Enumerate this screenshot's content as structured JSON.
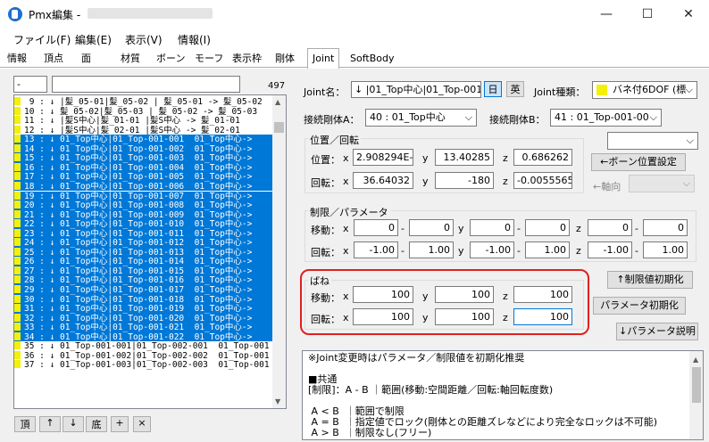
{
  "window": {
    "title": "Pmx編集 -",
    "minimize": "—",
    "maximize": "☐",
    "close": "✕"
  },
  "menu": [
    "ファイル(F)",
    "編集(E)",
    "表示(V)",
    "情報(I)"
  ],
  "tabs": [
    "情報",
    "頂点",
    "面",
    "材質",
    "ボーン",
    "モーフ",
    "表示枠",
    "剛体",
    "Joint",
    "SoftBody"
  ],
  "active_tab": "Joint",
  "list": {
    "filter_value": "-",
    "count": "497",
    "rows": [
      {
        "text": " 9 : ↓ |髪_05-01|髪_05-02 | 髪_05-01 -> 髪_05-02",
        "sel": false
      },
      {
        "text": "10 : ↓ 髪_05-02|髪_05-03 | 髪_05-02 -> 髪_05-03",
        "sel": false
      },
      {
        "text": "11 : ↓ |髪S中心|髪_01-01 |髪S中心 -> 髪_01-01",
        "sel": false
      },
      {
        "text": "12 : ↓ |髪S中心|髪_02-01 |髪S中心 -> 髪_02-01",
        "sel": false
      },
      {
        "text": "13 : ↓ 01_Top中心|01_Top-001-001  01_Top中心->",
        "sel": true
      },
      {
        "text": "14 : ↓ 01_Top中心|01_Top-001-002  01_Top中心->",
        "sel": true
      },
      {
        "text": "15 : ↓ 01_Top中心|01_Top-001-003  01_Top中心->",
        "sel": true
      },
      {
        "text": "16 : ↓ 01_Top中心|01_Top-001-004  01_Top中心->",
        "sel": true
      },
      {
        "text": "17 : ↓ 01_Top中心|01_Top-001-005  01_Top中心->",
        "sel": true
      },
      {
        "text": "18 : ↓ 01_Top中心|01_Top-001-006  01_Top中心->",
        "sel": true
      },
      {
        "text": "19 : ↓ 01_Top中心|01_Top-001-007  01_Top中心->",
        "sel": true
      },
      {
        "text": "20 : ↓ 01_Top中心|01_Top-001-008  01_Top中心->",
        "sel": true
      },
      {
        "text": "21 : ↓ 01_Top中心|01_Top-001-009  01_Top中心->",
        "sel": true
      },
      {
        "text": "22 : ↓ 01_Top中心|01_Top-001-010  01_Top中心->",
        "sel": true
      },
      {
        "text": "23 : ↓ 01_Top中心|01_Top-001-011  01_Top中心->",
        "sel": true
      },
      {
        "text": "24 : ↓ 01_Top中心|01_Top-001-012  01_Top中心->",
        "sel": true
      },
      {
        "text": "25 : ↓ 01_Top中心|01_Top-001-013  01_Top中心->",
        "sel": true
      },
      {
        "text": "26 : ↓ 01_Top中心|01_Top-001-014  01_Top中心->",
        "sel": true
      },
      {
        "text": "27 : ↓ 01_Top中心|01_Top-001-015  01_Top中心->",
        "sel": true
      },
      {
        "text": "28 : ↓ 01_Top中心|01_Top-001-016  01_Top中心->",
        "sel": true
      },
      {
        "text": "29 : ↓ 01_Top中心|01_Top-001-017  01_Top中心->",
        "sel": true
      },
      {
        "text": "30 : ↓ 01_Top中心|01_Top-001-018  01_Top中心->",
        "sel": true
      },
      {
        "text": "31 : ↓ 01_Top中心|01_Top-001-019  01_Top中心->",
        "sel": true
      },
      {
        "text": "32 : ↓ 01_Top中心|01_Top-001-020  01_Top中心->",
        "sel": true
      },
      {
        "text": "33 : ↓ 01_Top中心|01_Top-001-021  01_Top中心->",
        "sel": true
      },
      {
        "text": "34 : ↓ 01_Top中心|01_Top-001-022  01_Top中心->",
        "sel": true
      },
      {
        "text": "35 : ↓ 01_Top-001-001|01_Top-002-001  01_Top-001",
        "sel": false
      },
      {
        "text": "36 : ↓ 01_Top-001-002|01_Top-002-002  01_Top-001",
        "sel": false
      },
      {
        "text": "37 : ↓ 01_Top-001-003|01_Top-002-003  01_Top-001",
        "sel": false
      }
    ],
    "buttons": [
      "頂",
      "↑",
      "↓",
      "底",
      "+",
      "×"
    ]
  },
  "joint": {
    "name_label": "Joint名：",
    "name_value": "↓ |01_Top中心|01_Top-001-",
    "lang_jp": "日",
    "lang_en": "英",
    "type_label": "Joint種類：",
    "type_value": "バネ付6DOF (標",
    "body_a_label": "接続剛体A：",
    "body_a_value": "40 : 01_Top中心",
    "body_b_label": "接続剛体B：",
    "body_b_value": "41 : 01_Top-001-00"
  },
  "posrot": {
    "title": "位置／回転",
    "pos_label": "位置：",
    "rot_label": "回転：",
    "x": "x",
    "y": "y",
    "z": "z",
    "pos": [
      "2.908294E-(",
      "13.40285",
      "0.686262"
    ],
    "rot": [
      "36.64032",
      "-180",
      "-0.00555651"
    ],
    "bone_pos_button": "←ボーン位置設定",
    "axis_label": "←軸向"
  },
  "limits": {
    "title": "制限／パラメータ",
    "move_label": "移動：",
    "rot_label": "回転：",
    "move": [
      "0",
      "0",
      "0",
      "0",
      "0",
      "0"
    ],
    "rot": [
      "-1.00",
      "1.00",
      "-1.00",
      "1.00",
      "-1.00",
      "1.00"
    ]
  },
  "spring": {
    "title": "ばね",
    "move_label": "移動：",
    "rot_label": "回転：",
    "move": [
      "100",
      "100",
      "100"
    ],
    "rot": [
      "100",
      "100",
      "100"
    ]
  },
  "buttons": {
    "limit_init": "↑制限値初期化",
    "param_init": "パラメータ初期化",
    "param_desc": "↓パラメータ説明"
  },
  "description": [
    "※Joint変更時はパラメータ／制限値を初期化推奨",
    "",
    "■共通",
    "[制限]：A - B ｜範囲(移動:空間距離／回転:軸回転度数)",
    "",
    " A < B  ｜範囲で制限",
    " A = B  ｜指定値でロック(剛体との距離ズレなどにより完全なロックは不可能)",
    " A > B  ｜制限なし(フリー)"
  ],
  "colors": {
    "selection": "#0078d7",
    "marker": "#f3f00a",
    "highlight": "#e02020"
  }
}
